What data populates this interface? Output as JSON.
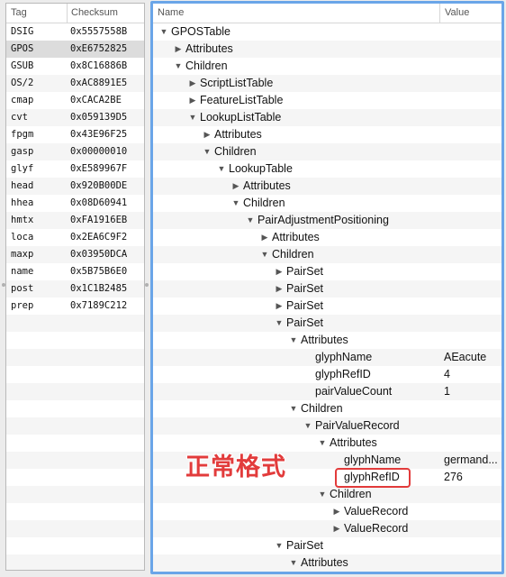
{
  "left_table": {
    "headers": {
      "tag": "Tag",
      "checksum": "Checksum"
    },
    "selected_tag": "GPOS",
    "rows": [
      {
        "tag": "DSIG",
        "checksum": "0x5557558B"
      },
      {
        "tag": "GPOS",
        "checksum": "0xE6752825"
      },
      {
        "tag": "GSUB",
        "checksum": "0x8C16886B"
      },
      {
        "tag": "OS/2",
        "checksum": "0xAC8891E5"
      },
      {
        "tag": "cmap",
        "checksum": "0xCACA2BE"
      },
      {
        "tag": "cvt",
        "checksum": "0x059139D5"
      },
      {
        "tag": "fpgm",
        "checksum": "0x43E96F25"
      },
      {
        "tag": "gasp",
        "checksum": "0x00000010"
      },
      {
        "tag": "glyf",
        "checksum": "0xE589967F"
      },
      {
        "tag": "head",
        "checksum": "0x920B00DE"
      },
      {
        "tag": "hhea",
        "checksum": "0x08D60941"
      },
      {
        "tag": "hmtx",
        "checksum": "0xFA1916EB"
      },
      {
        "tag": "loca",
        "checksum": "0x2EA6C9F2"
      },
      {
        "tag": "maxp",
        "checksum": "0x03950DCA"
      },
      {
        "tag": "name",
        "checksum": "0x5B75B6E0"
      },
      {
        "tag": "post",
        "checksum": "0x1C1B2485"
      },
      {
        "tag": "prep",
        "checksum": "0x7189C212"
      }
    ]
  },
  "tree": {
    "headers": {
      "name": "Name",
      "value": "Value"
    },
    "rows": [
      {
        "label": "GPOSTable",
        "depth": 0,
        "toggle": "open",
        "value": ""
      },
      {
        "label": "Attributes",
        "depth": 1,
        "toggle": "closed",
        "value": ""
      },
      {
        "label": "Children",
        "depth": 1,
        "toggle": "open",
        "value": ""
      },
      {
        "label": "ScriptListTable",
        "depth": 2,
        "toggle": "closed",
        "value": ""
      },
      {
        "label": "FeatureListTable",
        "depth": 2,
        "toggle": "closed",
        "value": ""
      },
      {
        "label": "LookupListTable",
        "depth": 2,
        "toggle": "open",
        "value": ""
      },
      {
        "label": "Attributes",
        "depth": 3,
        "toggle": "closed",
        "value": ""
      },
      {
        "label": "Children",
        "depth": 3,
        "toggle": "open",
        "value": ""
      },
      {
        "label": "LookupTable",
        "depth": 4,
        "toggle": "open",
        "value": ""
      },
      {
        "label": "Attributes",
        "depth": 5,
        "toggle": "closed",
        "value": ""
      },
      {
        "label": "Children",
        "depth": 5,
        "toggle": "open",
        "value": ""
      },
      {
        "label": "PairAdjustmentPositioning",
        "depth": 6,
        "toggle": "open",
        "value": ""
      },
      {
        "label": "Attributes",
        "depth": 7,
        "toggle": "closed",
        "value": ""
      },
      {
        "label": "Children",
        "depth": 7,
        "toggle": "open",
        "value": ""
      },
      {
        "label": "PairSet",
        "depth": 8,
        "toggle": "closed",
        "value": ""
      },
      {
        "label": "PairSet",
        "depth": 8,
        "toggle": "closed",
        "value": ""
      },
      {
        "label": "PairSet",
        "depth": 8,
        "toggle": "closed",
        "value": ""
      },
      {
        "label": "PairSet",
        "depth": 8,
        "toggle": "open",
        "value": ""
      },
      {
        "label": "Attributes",
        "depth": 9,
        "toggle": "open",
        "value": ""
      },
      {
        "label": "glyphName",
        "depth": 10,
        "toggle": "none",
        "value": "AEacute"
      },
      {
        "label": "glyphRefID",
        "depth": 10,
        "toggle": "none",
        "value": "4"
      },
      {
        "label": "pairValueCount",
        "depth": 10,
        "toggle": "none",
        "value": "1"
      },
      {
        "label": "Children",
        "depth": 9,
        "toggle": "open",
        "value": ""
      },
      {
        "label": "PairValueRecord",
        "depth": 10,
        "toggle": "open",
        "value": ""
      },
      {
        "label": "Attributes",
        "depth": 11,
        "toggle": "open",
        "value": ""
      },
      {
        "label": "glyphName",
        "depth": 12,
        "toggle": "none",
        "value": "germand..."
      },
      {
        "label": "glyphRefID",
        "depth": 12,
        "toggle": "none",
        "value": "276"
      },
      {
        "label": "Children",
        "depth": 11,
        "toggle": "open",
        "value": ""
      },
      {
        "label": "ValueRecord",
        "depth": 12,
        "toggle": "closed",
        "value": ""
      },
      {
        "label": "ValueRecord",
        "depth": 12,
        "toggle": "closed",
        "value": ""
      },
      {
        "label": "PairSet",
        "depth": 8,
        "toggle": "open",
        "value": ""
      },
      {
        "label": "Attributes",
        "depth": 9,
        "toggle": "open",
        "value": ""
      }
    ]
  },
  "annotation": {
    "text": "正常格式",
    "color": "#e23b3b"
  },
  "colors": {
    "focus_border": "#6aa5e8",
    "highlight": "#e23b3b"
  },
  "icons": {
    "expanded": "triangle-down-icon",
    "collapsed": "triangle-right-icon"
  }
}
